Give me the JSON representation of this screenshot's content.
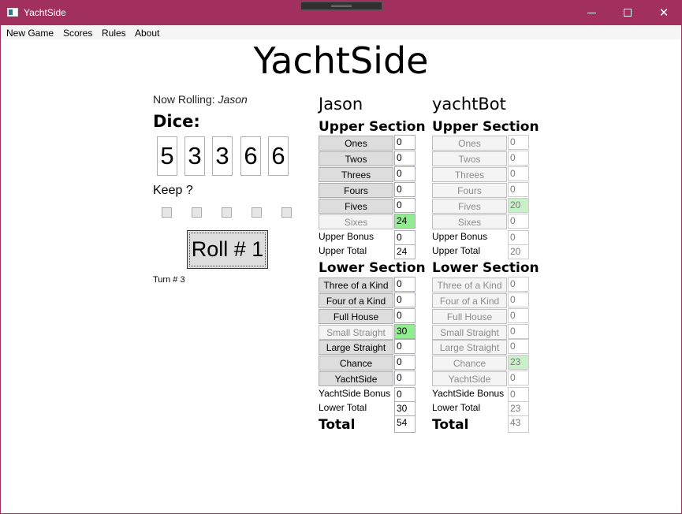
{
  "window": {
    "title": "YachtSide",
    "controls": {
      "minimize": "–",
      "maximize": "☐",
      "close": "✕"
    }
  },
  "menu": [
    "New Game",
    "Scores",
    "Rules",
    "About"
  ],
  "app_title": "YachtSide",
  "now_rolling": {
    "label": "Now Rolling:",
    "player": "Jason"
  },
  "dice_label": "Dice:",
  "dice": [
    "5",
    "3",
    "3",
    "6",
    "6"
  ],
  "keep_label": "Keep ?",
  "keep_checked": [
    false,
    false,
    false,
    false,
    false
  ],
  "roll_button": "Roll # 1",
  "turn_label": "Turn # 3",
  "labels": {
    "upper_section": "Upper Section",
    "lower_section": "Lower Section",
    "upper_bonus": "Upper Bonus",
    "upper_total": "Upper Total",
    "yachtside_bonus": "YachtSide Bonus",
    "lower_total": "Lower Total",
    "total": "Total"
  },
  "players": [
    {
      "name": "Jason",
      "upper": [
        {
          "label": "Ones",
          "score": "0",
          "used": false,
          "highlight": false
        },
        {
          "label": "Twos",
          "score": "0",
          "used": false,
          "highlight": false
        },
        {
          "label": "Threes",
          "score": "0",
          "used": false,
          "highlight": false
        },
        {
          "label": "Fours",
          "score": "0",
          "used": false,
          "highlight": false
        },
        {
          "label": "Fives",
          "score": "0",
          "used": false,
          "highlight": false
        },
        {
          "label": "Sixes",
          "score": "24",
          "used": true,
          "highlight": true
        }
      ],
      "upper_bonus": "0",
      "upper_total": "24",
      "lower": [
        {
          "label": "Three of a Kind",
          "score": "0",
          "used": false,
          "highlight": false
        },
        {
          "label": "Four of a Kind",
          "score": "0",
          "used": false,
          "highlight": false
        },
        {
          "label": "Full House",
          "score": "0",
          "used": false,
          "highlight": false
        },
        {
          "label": "Small Straight",
          "score": "30",
          "used": true,
          "highlight": true
        },
        {
          "label": "Large Straight",
          "score": "0",
          "used": false,
          "highlight": false
        },
        {
          "label": "Chance",
          "score": "0",
          "used": false,
          "highlight": false
        },
        {
          "label": "YachtSide",
          "score": "0",
          "used": false,
          "highlight": false
        }
      ],
      "yachtside_bonus": "0",
      "lower_total": "30",
      "total": "54",
      "active": true
    },
    {
      "name": "yachtBot",
      "upper": [
        {
          "label": "Ones",
          "score": "0",
          "used": false,
          "highlight": false
        },
        {
          "label": "Twos",
          "score": "0",
          "used": false,
          "highlight": false
        },
        {
          "label": "Threes",
          "score": "0",
          "used": false,
          "highlight": false
        },
        {
          "label": "Fours",
          "score": "0",
          "used": false,
          "highlight": false
        },
        {
          "label": "Fives",
          "score": "20",
          "used": true,
          "highlight": true
        },
        {
          "label": "Sixes",
          "score": "0",
          "used": false,
          "highlight": false
        }
      ],
      "upper_bonus": "0",
      "upper_total": "20",
      "lower": [
        {
          "label": "Three of a Kind",
          "score": "0",
          "used": false,
          "highlight": false
        },
        {
          "label": "Four of a Kind",
          "score": "0",
          "used": false,
          "highlight": false
        },
        {
          "label": "Full House",
          "score": "0",
          "used": false,
          "highlight": false
        },
        {
          "label": "Small Straight",
          "score": "0",
          "used": false,
          "highlight": false
        },
        {
          "label": "Large Straight",
          "score": "0",
          "used": false,
          "highlight": false
        },
        {
          "label": "Chance",
          "score": "23",
          "used": true,
          "highlight": true
        },
        {
          "label": "YachtSide",
          "score": "0",
          "used": false,
          "highlight": false
        }
      ],
      "yachtside_bonus": "0",
      "lower_total": "23",
      "total": "43",
      "active": false
    }
  ],
  "colors": {
    "titlebar": "#a2305e",
    "highlight": "#90ee90"
  }
}
